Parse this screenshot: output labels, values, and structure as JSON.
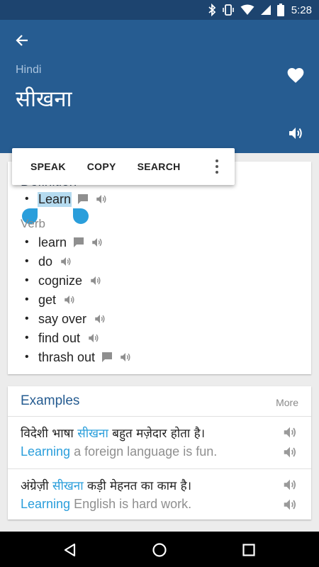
{
  "status_bar": {
    "time": "5:28",
    "icons": [
      "bluetooth-icon",
      "vibrate-icon",
      "wifi-icon",
      "signal-icon",
      "battery-icon"
    ]
  },
  "header": {
    "language": "Hindi",
    "word": "सीखना",
    "icons": {
      "back": "arrow-left-icon",
      "favorite": "heart-icon",
      "speak": "speaker-icon"
    }
  },
  "context_menu": {
    "items": [
      "SPEAK",
      "COPY",
      "SEARCH"
    ],
    "more_icon": "more-vert-icon"
  },
  "definition": {
    "heading": "Definition",
    "top_term": "Learn",
    "part_of_speech": "Verb",
    "terms": [
      {
        "text": "learn",
        "comment_icon": true
      },
      {
        "text": "do",
        "comment_icon": false
      },
      {
        "text": "cognize",
        "comment_icon": false
      },
      {
        "text": "get",
        "comment_icon": false
      },
      {
        "text": "say over",
        "comment_icon": false
      },
      {
        "text": "find out",
        "comment_icon": false
      },
      {
        "text": "thrash out",
        "comment_icon": true
      }
    ]
  },
  "examples": {
    "heading": "Examples",
    "more_label": "More",
    "items": [
      {
        "source_before": "विदेशी भाषा ",
        "source_highlight": "सीखना",
        "source_after": " बहुत मज़ेदार होता है।",
        "translation_highlight": "Learning",
        "translation_after": " a foreign language is fun."
      },
      {
        "source_before": "अंग्रेज़ी ",
        "source_highlight": "सीखना",
        "source_after": " कड़ी मेहनत का काम है।",
        "translation_highlight": "Learning",
        "translation_after": " English is hard work."
      }
    ]
  },
  "colors": {
    "status_bar": "#1d446f",
    "header": "#265c91",
    "accent": "#2a9edb",
    "selection": "#b5dbf0"
  }
}
